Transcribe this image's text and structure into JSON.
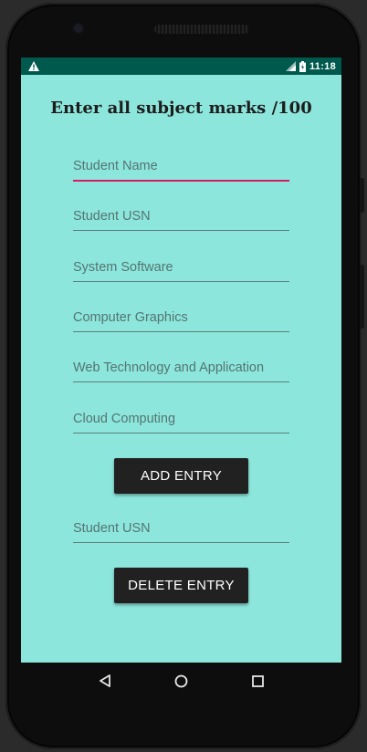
{
  "status_bar": {
    "time": "11:18",
    "icons": [
      "warning-icon",
      "signal-icon",
      "battery-icon"
    ]
  },
  "form": {
    "title": "Enter all subject marks /100",
    "fields": [
      {
        "placeholder": "Student Name",
        "value": "",
        "focused": true
      },
      {
        "placeholder": "Student USN",
        "value": ""
      },
      {
        "placeholder": "System Software",
        "value": ""
      },
      {
        "placeholder": "Computer Graphics",
        "value": ""
      },
      {
        "placeholder": "Web Technology and Application",
        "value": ""
      },
      {
        "placeholder": "Cloud Computing",
        "value": ""
      }
    ],
    "add_button_label": "ADD ENTRY",
    "delete_field": {
      "placeholder": "Student USN",
      "value": ""
    },
    "delete_button_label": "DELETE ENTRY"
  },
  "nav_bar": {
    "icons": [
      "back-icon",
      "home-icon",
      "recents-icon"
    ]
  },
  "colors": {
    "background": "#8de6dc",
    "status_bar": "#00594d",
    "accent": "#d81b60",
    "button": "#212121"
  }
}
